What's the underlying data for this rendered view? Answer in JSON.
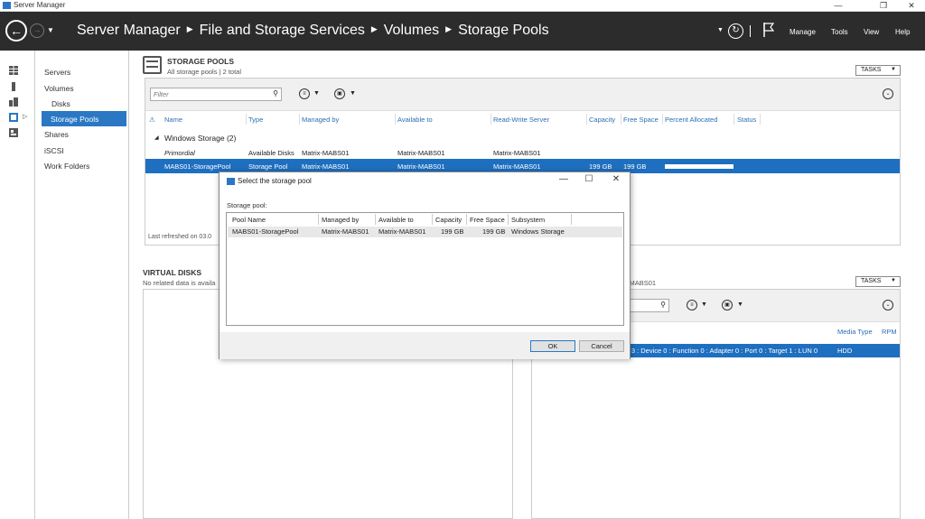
{
  "window": {
    "title": "Server Manager",
    "controls": [
      "—",
      "❐",
      "✕"
    ]
  },
  "header": {
    "breadcrumb": [
      "Server Manager",
      "File and Storage Services",
      "Volumes",
      "Storage Pools"
    ],
    "menu": [
      "Manage",
      "Tools",
      "View",
      "Help"
    ]
  },
  "rail": {
    "icons": [
      "dashboard-icon",
      "local-server-icon",
      "all-servers-icon",
      "file-storage-icon",
      "servers-group-icon"
    ]
  },
  "nav": {
    "items": [
      {
        "label": "Servers",
        "indent": false,
        "selected": false
      },
      {
        "label": "Volumes",
        "indent": false,
        "selected": false
      },
      {
        "label": "Disks",
        "indent": true,
        "selected": false
      },
      {
        "label": "Storage Pools",
        "indent": true,
        "selected": true
      },
      {
        "label": "Shares",
        "indent": false,
        "selected": false
      },
      {
        "label": "iSCSI",
        "indent": false,
        "selected": false
      },
      {
        "label": "Work Folders",
        "indent": false,
        "selected": false
      }
    ]
  },
  "pools": {
    "title": "STORAGE POOLS",
    "subtitle": "All storage pools | 2 total",
    "tasks_label": "TASKS",
    "filter_placeholder": "Filter",
    "columns": [
      "Name",
      "Type",
      "Managed by",
      "Available to",
      "Read-Write Server",
      "Capacity",
      "Free Space",
      "Percent Allocated",
      "Status"
    ],
    "group": "Windows Storage (2)",
    "rows": [
      {
        "name": "Primordial",
        "type": "Available Disks",
        "managed_by": "Matrix-MABS01",
        "available_to": "Matrix-MABS01",
        "rw_server": "Matrix-MABS01",
        "capacity": "",
        "free": "",
        "percent": null,
        "selected": false
      },
      {
        "name": "MABS01-StoragePool",
        "type": "Storage Pool",
        "managed_by": "Matrix-MABS01",
        "available_to": "Matrix-MABS01",
        "rw_server": "Matrix-MABS01",
        "capacity": "199 GB",
        "free": "199 GB",
        "percent": 1.0,
        "selected": true
      }
    ],
    "last_refreshed": "Last refreshed on 03.0"
  },
  "virtual_disks": {
    "title": "VIRTUAL DISKS",
    "subtitle": "No related data is availa"
  },
  "physical_disks": {
    "subtitle_partial": "-MABS01",
    "tasks_label": "TASKS",
    "columns": [
      "Media Type",
      "RPM"
    ],
    "row_text": "s 3 : Device 0 : Function 0 : Adapter 0 : Port 0 : Target 1 : LUN 0",
    "row_media": "HDD"
  },
  "dialog": {
    "title": "Select the storage pool",
    "controls": [
      "—",
      "☐",
      "✕"
    ],
    "label": "Storage pool:",
    "columns": [
      "Pool Name",
      "Managed by",
      "Available to",
      "Capacity",
      "Free Space",
      "Subsystem"
    ],
    "rows": [
      {
        "pool_name": "MABS01-StoragePool",
        "managed_by": "Matrix-MABS01",
        "available_to": "Matrix-MABS01",
        "capacity": "199 GB",
        "free_space": "199 GB",
        "subsystem": "Windows Storage"
      }
    ],
    "ok_label": "OK",
    "cancel_label": "Cancel"
  },
  "colors": {
    "header_bg": "#2c2c2c",
    "accent": "#2a78c4",
    "selection": "#1e6fc0"
  }
}
